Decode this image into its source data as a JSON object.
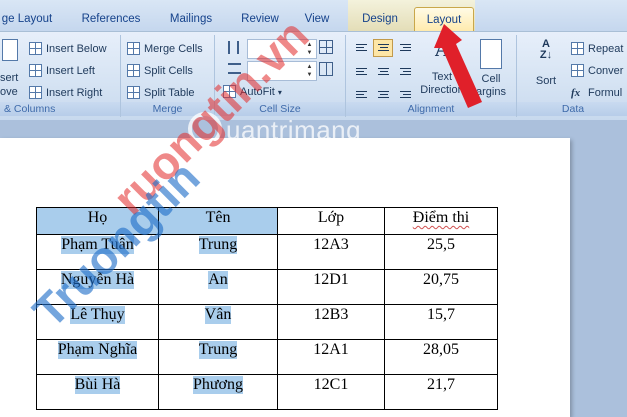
{
  "tabs": [
    {
      "label": "ge Layout"
    },
    {
      "label": "References"
    },
    {
      "label": "Mailings"
    },
    {
      "label": "Review"
    },
    {
      "label": "View"
    },
    {
      "label": "Design"
    },
    {
      "label": "Layout"
    }
  ],
  "ribbon": {
    "rows_columns": {
      "insert_partial": "sert",
      "above_partial": "ove",
      "insert_below": "Insert Below",
      "insert_left": "Insert Left",
      "insert_right": "Insert Right",
      "label": "& Columns"
    },
    "merge": {
      "merge_cells": "Merge Cells",
      "split_cells": "Split Cells",
      "split_table": "Split Table",
      "label": "Merge"
    },
    "cell_size": {
      "autofit": "AutoFit",
      "label": "Cell Size"
    },
    "alignment": {
      "text_direction_line1": "Text",
      "text_direction_line2": "Direction",
      "cell_margins_line1": "Cell",
      "cell_margins_line2": "argins",
      "label": "Alignment"
    },
    "data": {
      "sort": "Sort",
      "repeat_partial": "Repeat",
      "convert_partial": "Conver",
      "formula_partial": "Formul",
      "label": "Data"
    }
  },
  "watermarks": {
    "red": "ruongtin.vn",
    "blue": "Truongtin",
    "quantrimang": "uantrimang"
  },
  "table": {
    "headers": [
      "Họ",
      "Tên",
      "Lớp",
      "Điểm thi"
    ],
    "rows": [
      [
        "Phạm Tuân",
        "Trung",
        "12A3",
        "25,5"
      ],
      [
        "Nguyễn Hà",
        "An",
        "12D1",
        "20,75"
      ],
      [
        "Lê Thụy",
        "Vân",
        "12B3",
        "15,7"
      ],
      [
        "Phạm Nghĩa",
        "Trung",
        "12A1",
        "28,05"
      ],
      [
        "Bùi Hà",
        "Phương",
        "12C1",
        "21,7"
      ]
    ]
  },
  "colors": {
    "highlight": "#a9cdec",
    "arrow": "#e0202a"
  }
}
